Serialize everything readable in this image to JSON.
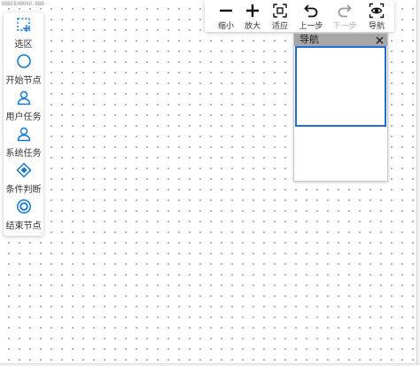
{
  "watermark": "BBBEE4B04D.BBB",
  "palette": {
    "items": [
      {
        "label": "选区",
        "icon": "selection-icon"
      },
      {
        "label": "开始节点",
        "icon": "circle-icon"
      },
      {
        "label": "用户任务",
        "icon": "user-icon"
      },
      {
        "label": "系统任务",
        "icon": "user-icon"
      },
      {
        "label": "条件判断",
        "icon": "diamond-icon"
      },
      {
        "label": "结束节点",
        "icon": "double-circle-icon"
      }
    ]
  },
  "toolbar": {
    "items": [
      {
        "label": "缩小",
        "icon": "minus-icon",
        "enabled": true
      },
      {
        "label": "放大",
        "icon": "plus-icon",
        "enabled": true
      },
      {
        "label": "适应",
        "icon": "fit-icon",
        "enabled": true
      },
      {
        "label": "上一步",
        "icon": "undo-icon",
        "enabled": true
      },
      {
        "label": "下一步",
        "icon": "redo-icon",
        "enabled": false
      },
      {
        "label": "导航",
        "icon": "eye-icon",
        "enabled": true
      }
    ]
  },
  "navigator": {
    "title": "导航",
    "close_symbol": "✕"
  },
  "colors": {
    "accent": "#1e6fd9",
    "icon_blue": "#1677d2",
    "header_gray": "#a6a6a6"
  }
}
